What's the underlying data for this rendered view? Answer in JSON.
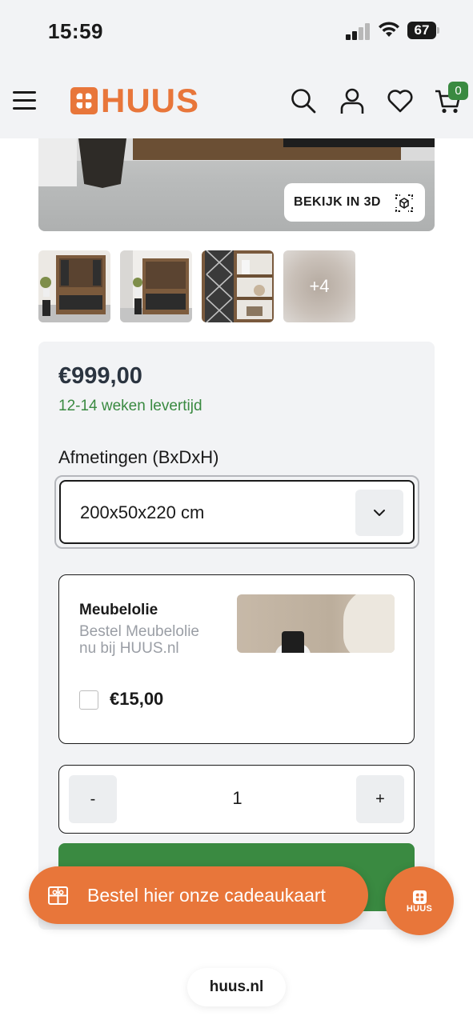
{
  "status_bar": {
    "time": "15:59",
    "battery": "67"
  },
  "header": {
    "brand": "HUUS",
    "cart_count": "0"
  },
  "hero": {
    "view_3d_label": "BEKIJK IN 3D"
  },
  "thumbnails": {
    "more_count": "+4"
  },
  "product": {
    "price": "€999,00",
    "delivery": "12-14 weken levertijd",
    "dimensions_label": "Afmetingen (BxDxH)",
    "dimensions_value": "200x50x220 cm"
  },
  "upsell": {
    "title": "Meubelolie",
    "description": "Bestel Meubelolie nu bij HUUS.nl",
    "price": "€15,00",
    "checked": false
  },
  "quantity": {
    "minus": "-",
    "value": "1",
    "plus": "+"
  },
  "giftcard": {
    "label": "Bestel hier onze cadeaukaart"
  },
  "chat_button": {
    "label": "HUUS"
  },
  "browser": {
    "url": "huus.nl"
  },
  "colors": {
    "brand_orange": "#e8763a",
    "accent_green": "#3a8a41",
    "panel_bg": "#f2f3f5"
  }
}
